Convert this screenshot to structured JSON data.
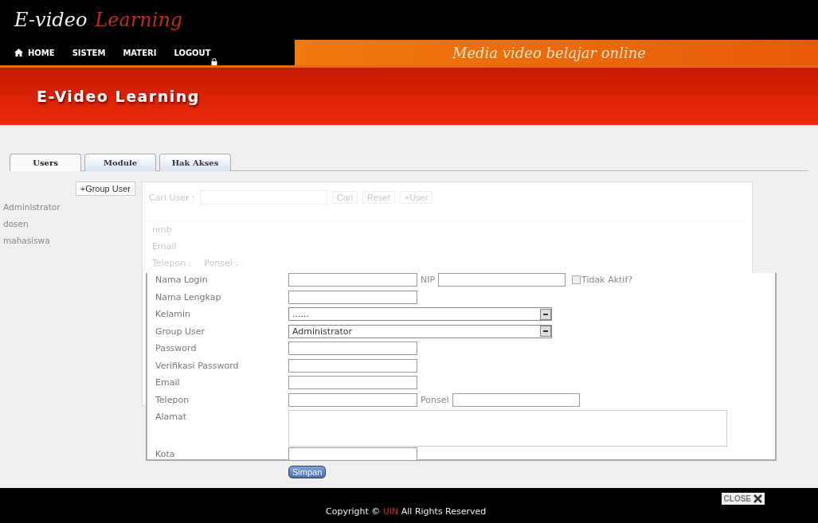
{
  "header": {
    "logo_first": "E-video",
    "logo_second": "Learning"
  },
  "nav": {
    "items": [
      {
        "label": "HOME"
      },
      {
        "label": "SISTEM"
      },
      {
        "label": "MATERI"
      },
      {
        "label": "LOGOUT"
      }
    ],
    "tagline": "Media video belajar online"
  },
  "banner": {
    "title": "E-Video Learning"
  },
  "tabs": [
    {
      "label": "Users",
      "selected": true
    },
    {
      "label": "Module",
      "selected": false
    },
    {
      "label": "Hak Akses",
      "selected": false
    }
  ],
  "sidebar": {
    "button": "+Group User",
    "items": [
      "Administrator",
      "dosen",
      "mahasiswa"
    ]
  },
  "background_panel": {
    "search_label": "Cari User :",
    "buttons": [
      "Cari",
      "Reset",
      "+User"
    ],
    "lines": [
      [
        "nmb"
      ],
      [
        "Email"
      ],
      [
        "Telepon :",
        "Ponsel :"
      ]
    ]
  },
  "form": {
    "rows": [
      {
        "kind": "text",
        "label": "Nama Login",
        "extra_label": "NIP",
        "checkbox": {
          "label": "Tidak Aktif?",
          "checked": false
        }
      },
      {
        "kind": "text",
        "label": "Nama Lengkap"
      },
      {
        "kind": "select",
        "label": "Kelamin",
        "value": "......"
      },
      {
        "kind": "select",
        "label": "Group User",
        "value": "Administrator"
      },
      {
        "kind": "text",
        "label": "Password"
      },
      {
        "kind": "text",
        "label": "Verifikasi Password"
      },
      {
        "kind": "text",
        "label": "Email"
      },
      {
        "kind": "text",
        "label": "Telepon",
        "extra_label": "Ponsel"
      },
      {
        "kind": "textarea",
        "label": "Alamat"
      },
      {
        "kind": "text",
        "label": "Kota"
      }
    ],
    "submit": "Simpan"
  },
  "footer": {
    "copyright_before": "Copyright ©",
    "copyright_brand": "UIN",
    "copyright_after": "All Rights Reserved",
    "close": "CLOSE"
  }
}
